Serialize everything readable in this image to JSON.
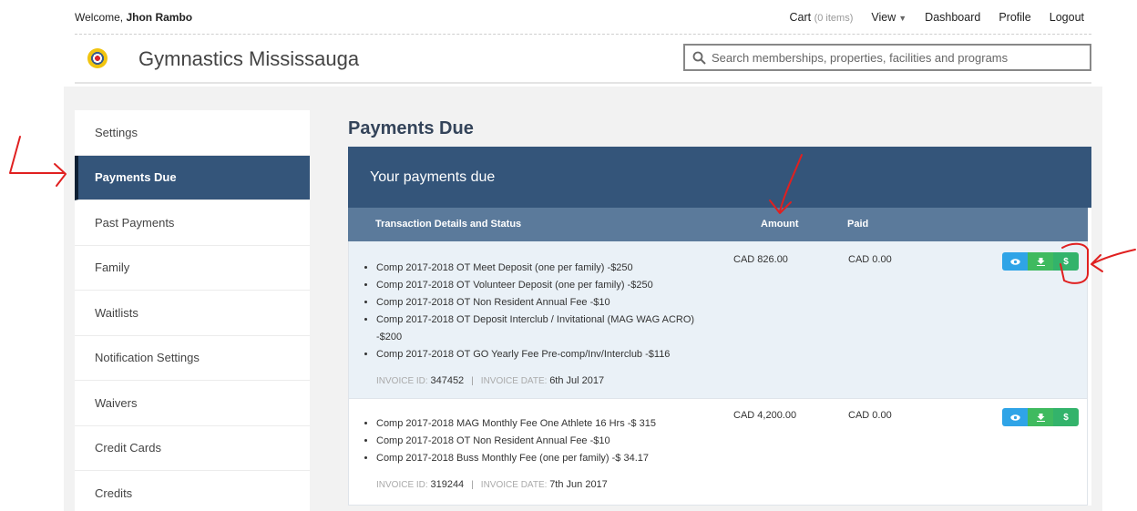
{
  "header": {
    "welcome_prefix": "Welcome, ",
    "user_name": "Jhon Rambo",
    "cart_label": "Cart",
    "cart_count": "(0 items)",
    "view_label": "View",
    "dashboard_label": "Dashboard",
    "profile_label": "Profile",
    "logout_label": "Logout"
  },
  "brand": {
    "name": "Gymnastics Mississauga"
  },
  "search": {
    "placeholder": "Search memberships, properties, facilities and programs"
  },
  "sidebar": {
    "items": [
      {
        "label": "Settings"
      },
      {
        "label": "Payments Due",
        "active": true
      },
      {
        "label": "Past Payments"
      },
      {
        "label": "Family"
      },
      {
        "label": "Waitlists"
      },
      {
        "label": "Notification Settings"
      },
      {
        "label": "Waivers"
      },
      {
        "label": "Credit Cards"
      },
      {
        "label": "Credits"
      }
    ]
  },
  "main": {
    "title": "Payments Due",
    "panel_title": "Your payments due",
    "columns": {
      "details": "Transaction Details and Status",
      "amount": "Amount",
      "paid": "Paid"
    },
    "invoices": [
      {
        "items": [
          "Comp 2017-2018 OT Meet Deposit (one per family) -$250",
          "Comp 2017-2018 OT Volunteer Deposit (one per family) -$250",
          "Comp 2017-2018 OT Non Resident Annual Fee -$10",
          "Comp 2017-2018 OT Deposit Interclub / Invitational (MAG WAG ACRO) -$200",
          "Comp 2017-2018 OT GO Yearly Fee Pre-comp/Inv/Interclub -$116"
        ],
        "invoice_id_label": "INVOICE ID:",
        "invoice_id": "347452",
        "invoice_date_label": "INVOICE DATE:",
        "invoice_date": "6th Jul 2017",
        "amount": "CAD 826.00",
        "paid": "CAD 0.00"
      },
      {
        "items": [
          "Comp 2017-2018 MAG Monthly Fee One Athlete 16 Hrs -$ 315",
          "Comp 2017-2018 OT Non Resident Annual Fee -$10",
          "Comp 2017-2018 Buss Monthly Fee (one per family) -$ 34.17"
        ],
        "invoice_id_label": "INVOICE ID:",
        "invoice_id": "319244",
        "invoice_date_label": "INVOICE DATE:",
        "invoice_date": "7th Jun 2017",
        "amount": "CAD 4,200.00",
        "paid": "CAD 0.00"
      }
    ],
    "action_icons": {
      "view": "eye-icon",
      "download": "download-icon",
      "pay": "dollar-icon",
      "pay_glyph": "$"
    }
  },
  "colors": {
    "primary": "#34557a",
    "table_header": "#5b7a9b",
    "view_button": "#2fa4e7",
    "download_button": "#3fba5f",
    "pay_button": "#33b36b",
    "annotation_red": "#e02020"
  }
}
